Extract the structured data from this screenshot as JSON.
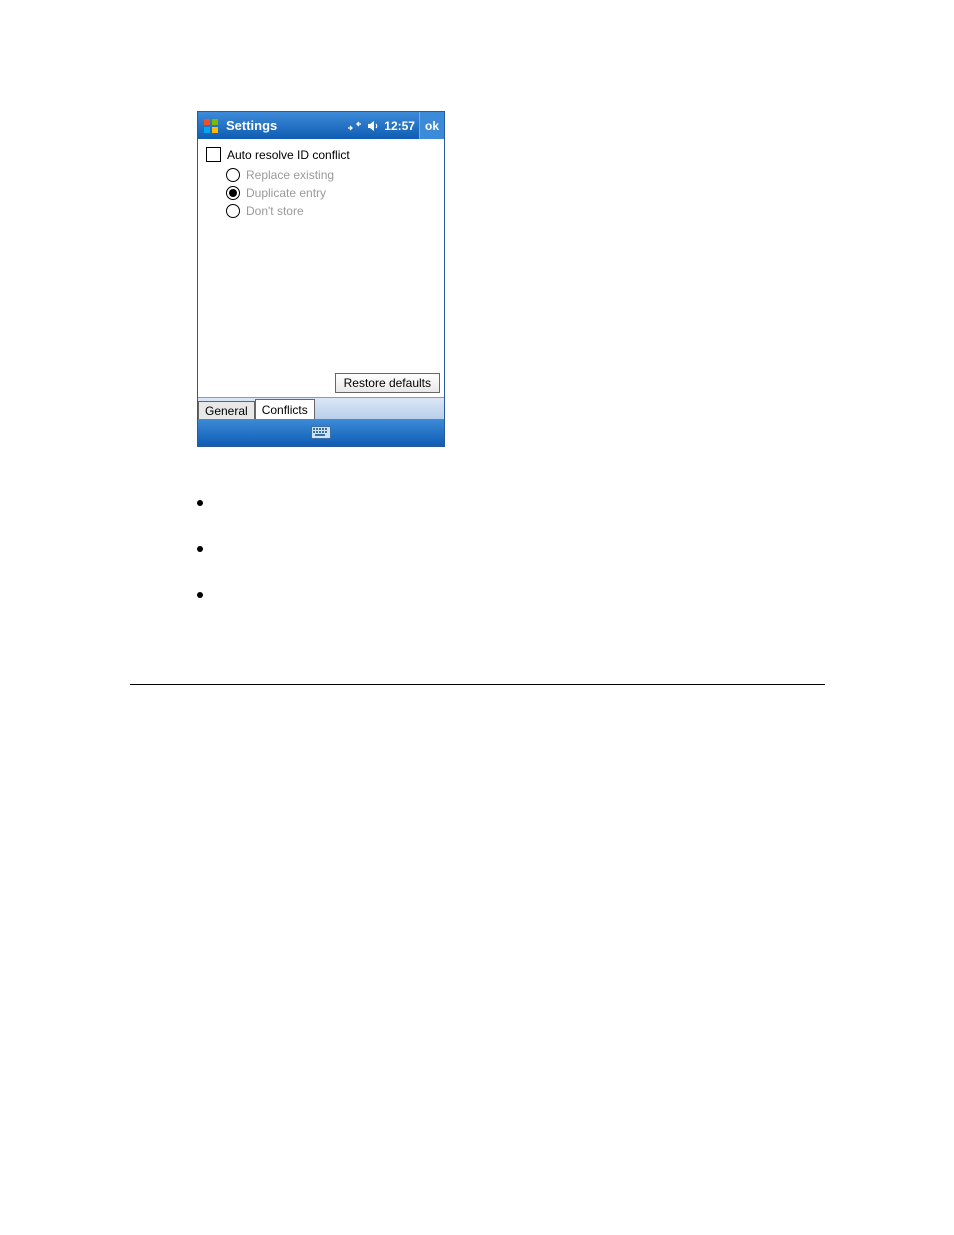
{
  "titlebar": {
    "title": "Settings",
    "time": "12:57",
    "ok_label": "ok"
  },
  "content": {
    "checkbox_label": "Auto resolve ID conflict",
    "radios": [
      {
        "label": "Replace existing",
        "selected": false
      },
      {
        "label": "Duplicate entry",
        "selected": true
      },
      {
        "label": "Don't store",
        "selected": false
      }
    ],
    "restore_label": "Restore defaults"
  },
  "tabs": [
    {
      "label": "General",
      "active": false
    },
    {
      "label": "Conflicts",
      "active": true
    }
  ]
}
